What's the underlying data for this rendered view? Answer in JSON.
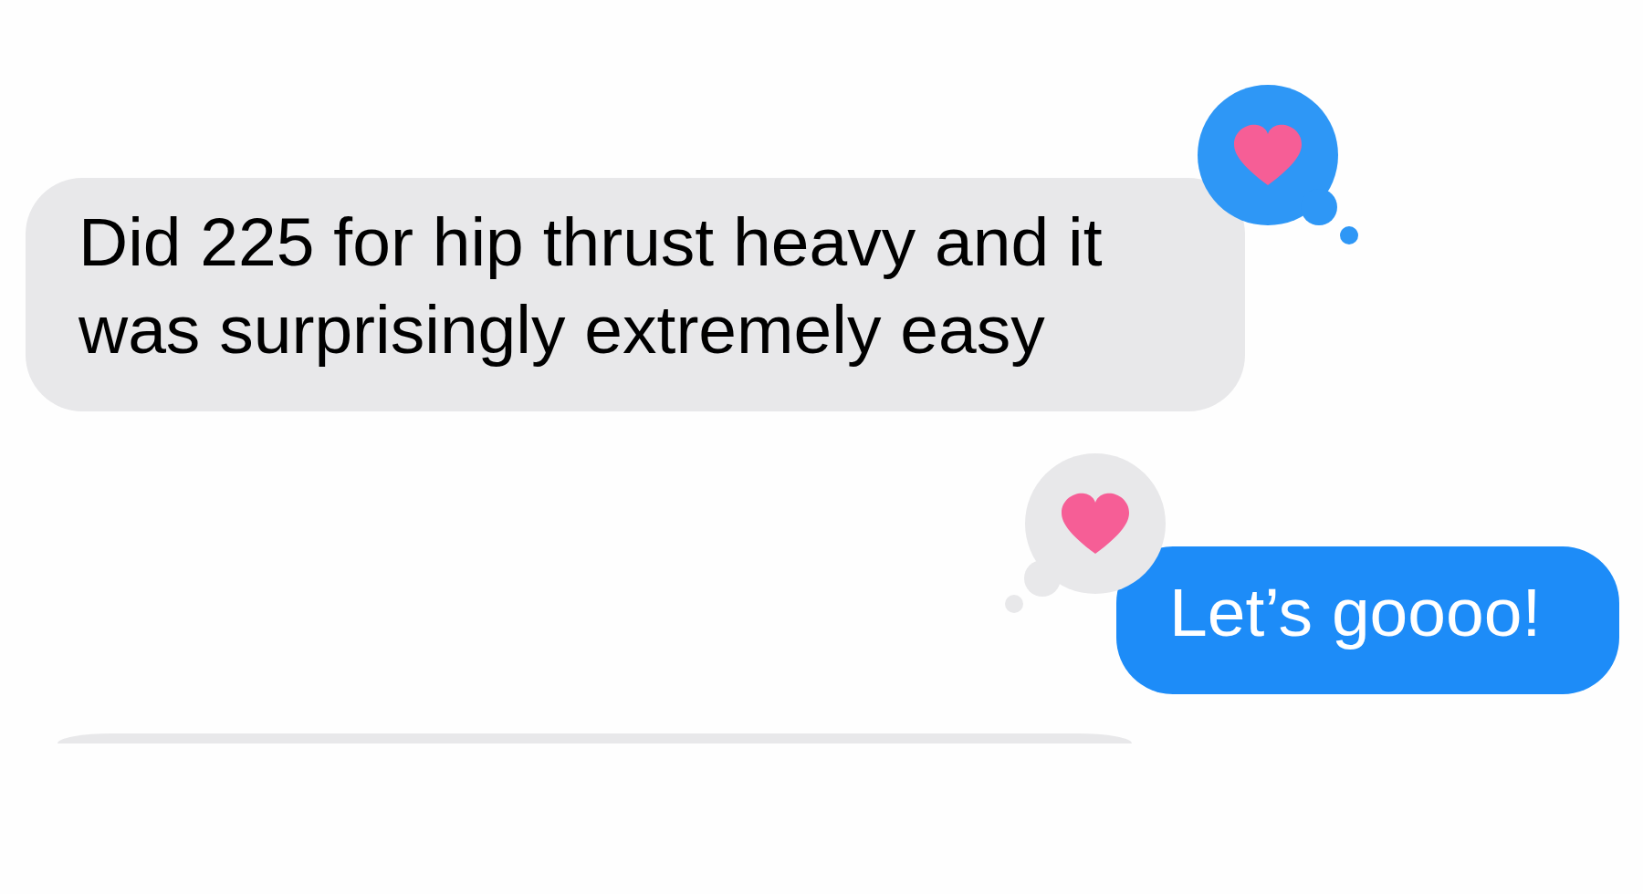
{
  "messages": [
    {
      "kind": "received",
      "text": "Did 225 for hip thrust heavy and it was surprisingly extremely easy",
      "reacted": true
    },
    {
      "kind": "sent",
      "text": "Let’s goooo!",
      "reacted": true
    },
    {
      "kind": "received"
    }
  ]
}
